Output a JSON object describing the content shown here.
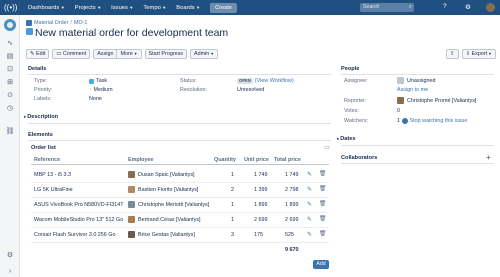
{
  "topbar": {
    "nav": [
      "Dashboards",
      "Projects",
      "Issues",
      "Tempo",
      "Boards"
    ],
    "create_label": "Create",
    "search_placeholder": "Search"
  },
  "breadcrumb": {
    "project": "Material Order",
    "issue_key": "MO-1"
  },
  "issue_title": "New material order for development team",
  "toolbar": {
    "edit": "Edit",
    "comment": "Comment",
    "assign": "Assign",
    "more": "More",
    "start_progress": "Start Progress",
    "admin": "Admin",
    "export": "Export"
  },
  "details": {
    "heading": "Details",
    "type_label": "Type:",
    "type_value": "Task",
    "priority_label": "Priority:",
    "priority_value": "Medium",
    "labels_label": "Labels:",
    "labels_value": "None",
    "status_label": "Status:",
    "status_value": "OPEN",
    "view_workflow": "(View Workflow)",
    "resolution_label": "Resolution:",
    "resolution_value": "Unresolved"
  },
  "description_heading": "Description",
  "elements_heading": "Elements",
  "order_list": {
    "title": "Order list",
    "columns": [
      "Reference",
      "Employee",
      "Quantity",
      "Unit price",
      "Total price"
    ],
    "rows": [
      {
        "reference": "MBP 13 - i5 3.3",
        "employee": "Dusan Spaic [Valiantys]",
        "quantity": "1",
        "unit_price": "1 749",
        "total_price": "1 749"
      },
      {
        "reference": "LG 5K UltraFine",
        "employee": "Bastien Fiorito [Valiantys]",
        "quantity": "2",
        "unit_price": "1 399",
        "total_price": "2 798"
      },
      {
        "reference": "ASUS VivoBook Pro N580VD-FI314T",
        "employee": "Christophe Meriotti [Valiantys]",
        "quantity": "1",
        "unit_price": "1 899",
        "total_price": "1 899"
      },
      {
        "reference": "Wacom MobileStudio Pro 13\" 512 Go",
        "employee": "Bertrand César [Valiantys]",
        "quantity": "1",
        "unit_price": "2 699",
        "total_price": "2 699"
      },
      {
        "reference": "Corsair Flash Survivor 3.0 256 Go",
        "employee": "Brice Gestas [Valiantys]",
        "quantity": "3",
        "unit_price": "175",
        "total_price": "525"
      }
    ],
    "grand_total": "9 670",
    "add_label": "Add"
  },
  "people": {
    "heading": "People",
    "assignee_label": "Assignee:",
    "assignee_value": "Unassigned",
    "assign_to_me": "Assign to me",
    "reporter_label": "Reporter:",
    "reporter_value": "Christophe Promé [Valiantys]",
    "votes_label": "Votes:",
    "votes_value": "0",
    "watchers_label": "Watchers:",
    "watchers_value": "1",
    "stop_watching": "Stop watching this issue"
  },
  "dates_heading": "Dates",
  "collaborators_heading": "Collaborators",
  "colors": {
    "header": "#205081",
    "link": "#3b73af",
    "primary_button": "#3b73af"
  }
}
